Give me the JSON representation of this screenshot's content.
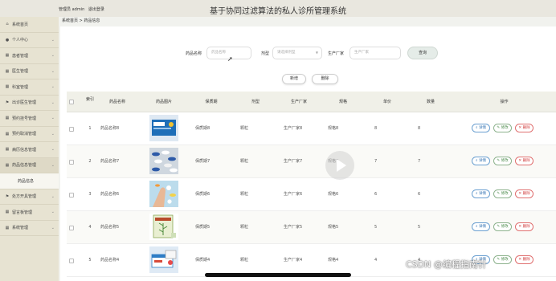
{
  "header": {
    "user_label": "管理员 admin",
    "logout_label": "退出登录",
    "title": "基于协同过滤算法的私人诊所管理系统"
  },
  "sidebar": {
    "items": [
      {
        "label": "系统首页",
        "icon": "home-icon",
        "glyph": "⌂",
        "chevron": false
      },
      {
        "label": "个人中心",
        "icon": "user-icon",
        "glyph": "●",
        "chevron": true
      },
      {
        "label": "患者管理",
        "icon": "grid-icon",
        "glyph": "▦",
        "chevron": true
      },
      {
        "label": "医生管理",
        "icon": "grid-icon",
        "glyph": "▦",
        "chevron": true
      },
      {
        "label": "科室管理",
        "icon": "grid-icon",
        "glyph": "▦",
        "chevron": true
      },
      {
        "label": "出诊医生管理",
        "icon": "flag-icon",
        "glyph": "⚑",
        "chevron": true
      },
      {
        "label": "预约挂号管理",
        "icon": "grid-icon",
        "glyph": "▦",
        "chevron": true
      },
      {
        "label": "预约取消管理",
        "icon": "grid-icon",
        "glyph": "▦",
        "chevron": true
      },
      {
        "label": "病历信息管理",
        "icon": "grid-icon",
        "glyph": "▦",
        "chevron": true
      },
      {
        "label": "药品信息管理",
        "icon": "grid-icon",
        "glyph": "▦",
        "chevron": true,
        "open": true
      },
      {
        "label": "药品信息",
        "sub": true
      },
      {
        "label": "处方开具管理",
        "icon": "flag-icon",
        "glyph": "⚑",
        "chevron": true
      },
      {
        "label": "留言板管理",
        "icon": "grid-icon",
        "glyph": "▦",
        "chevron": true
      },
      {
        "label": "系统管理",
        "icon": "grid-icon",
        "glyph": "▦",
        "chevron": true
      }
    ]
  },
  "breadcrumb": {
    "home": "系统首页",
    "separator": ">",
    "current": "药品信息"
  },
  "search": {
    "name_label": "药品名称",
    "name_placeholder": "药品名称",
    "type_label": "剂型",
    "type_placeholder": "请选择剂型",
    "maker_label": "生产厂家",
    "maker_placeholder": "生产厂家",
    "query_label": "查询"
  },
  "actions": {
    "add_label": "新增",
    "delete_label": "删除"
  },
  "table": {
    "columns": [
      "索引",
      "药品名称",
      "药品图片",
      "保质期",
      "剂型",
      "生产厂家",
      "规格",
      "单价",
      "数量",
      "操作"
    ],
    "rows": [
      {
        "index": "1",
        "name": "药品名称8",
        "expiry": "保质期8",
        "form": "颗粒",
        "maker": "生产厂家8",
        "spec": "规格8",
        "price": "8",
        "qty": "8",
        "image": "blue-box"
      },
      {
        "index": "2",
        "name": "药品名称7",
        "expiry": "保质期7",
        "form": "颗粒",
        "maker": "生产厂家7",
        "spec": "规格7",
        "price": "7",
        "qty": "7",
        "image": "capsules"
      },
      {
        "index": "3",
        "name": "药品名称6",
        "expiry": "保质期6",
        "form": "颗粒",
        "maker": "生产厂家6",
        "spec": "规格6",
        "price": "6",
        "qty": "6",
        "image": "pills-hand"
      },
      {
        "index": "4",
        "name": "药品名称5",
        "expiry": "保质期5",
        "form": "颗粒",
        "maker": "生产厂家5",
        "spec": "规格5",
        "price": "5",
        "qty": "5",
        "image": "herbal-box"
      },
      {
        "index": "5",
        "name": "药品名称4",
        "expiry": "保质期4",
        "form": "颗粒",
        "maker": "生产厂家4",
        "spec": "规格4",
        "price": "4",
        "qty": "4",
        "image": "medicine-box"
      }
    ],
    "op_detail": "详情",
    "op_edit": "修改",
    "op_delete": "删除"
  },
  "watermark": "CSDN @编程指南针",
  "colors": {
    "sidebar_bg": "#e7e3d2",
    "header_bg": "#e9e7df",
    "detail": "#2f6fb0",
    "edit": "#4a8a4a",
    "delete": "#d03a3a"
  }
}
